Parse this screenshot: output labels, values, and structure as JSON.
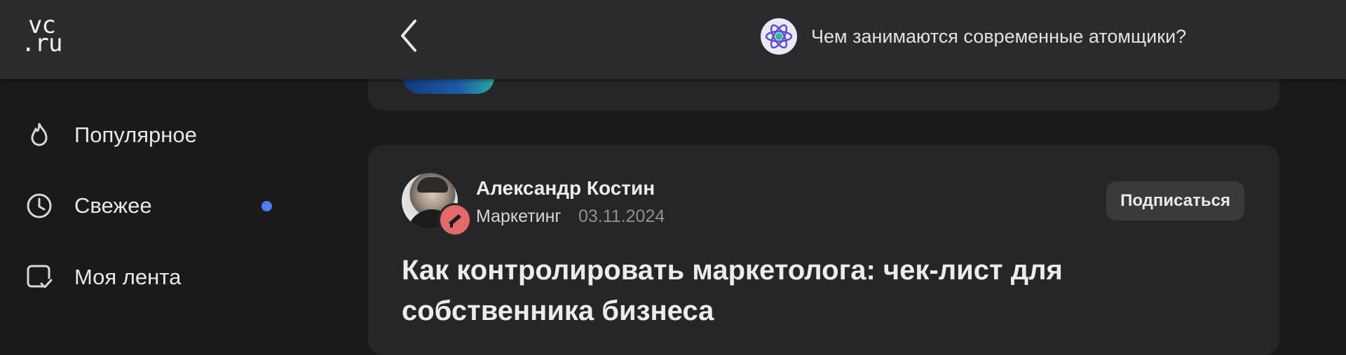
{
  "header": {
    "logo_line1": "vc",
    "logo_line2": ".ru",
    "topic_title": "Чем занимаются современные атомщики?"
  },
  "sidebar": {
    "items": [
      {
        "label": "Популярное",
        "icon": "flame-icon"
      },
      {
        "label": "Свежее",
        "icon": "clock-icon",
        "has_new_dot": true
      },
      {
        "label": "Моя лента",
        "icon": "feed-check-icon"
      }
    ]
  },
  "post": {
    "author": "Александр Костин",
    "category": "Маркетинг",
    "date": "03.11.2024",
    "subscribe_label": "Подписаться",
    "title": "Как контролировать маркетолога: чек-лист для собственника бизнеса"
  },
  "colors": {
    "header_bg": "#2b2b2d",
    "page_bg": "#1a1a1a",
    "card_bg": "#262628",
    "accent_dot": "#4f7cf0",
    "badge": "#e46a6a"
  }
}
